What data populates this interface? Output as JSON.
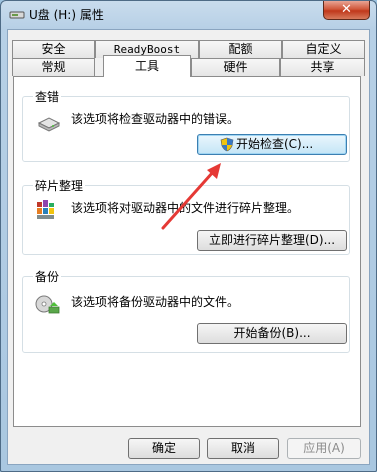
{
  "window": {
    "title": "U盘 (H:) 属性",
    "close_symbol": "✕"
  },
  "tabs_row1": [
    "安全",
    "ReadyBoost",
    "配额",
    "自定义"
  ],
  "tabs_row2": [
    "常规",
    "工具",
    "硬件",
    "共享"
  ],
  "selected_tab": "工具",
  "error_checking": {
    "title": "查错",
    "description": "该选项将检查驱动器中的错误。",
    "button": "开始检查(C)..."
  },
  "defragmentation": {
    "title": "碎片整理",
    "description": "该选项将对驱动器中的文件进行碎片整理。",
    "button": "立即进行碎片整理(D)..."
  },
  "backup": {
    "title": "备份",
    "description": "该选项将备份驱动器中的文件。",
    "button": "开始备份(B)..."
  },
  "footer": {
    "ok": "确定",
    "cancel": "取消",
    "apply": "应用(A)"
  },
  "colors": {
    "annotation_arrow": "#e53935",
    "title_bar": "#b7d0e6"
  }
}
